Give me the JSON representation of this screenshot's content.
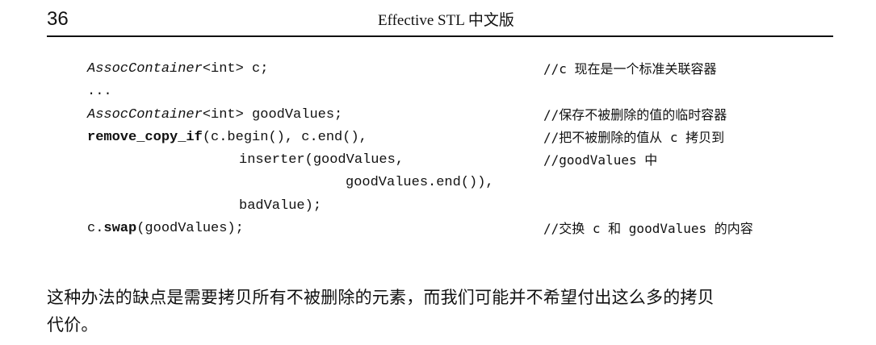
{
  "header": {
    "page_number": "36",
    "running_title": "Effective STL 中文版"
  },
  "code": {
    "line1": {
      "type_name": "AssocContainer",
      "rest": "<int> c;",
      "comment": "//c 现在是一个标准关联容器"
    },
    "line2": {
      "text": "..."
    },
    "line3": {
      "type_name": "AssocContainer",
      "rest": "<int> goodValues;",
      "comment": "//保存不被删除的值的临时容器"
    },
    "line4": {
      "func": "remove_copy_if",
      "rest": "(c.begin(), c.end(),",
      "comment": "//把不被删除的值从 c 拷贝到"
    },
    "line5": {
      "text": "inserter(goodValues,",
      "comment": "//goodValues 中"
    },
    "line6": {
      "text": "goodValues.end()),"
    },
    "line7": {
      "text": "badValue);"
    },
    "line8": {
      "prefix": "c.",
      "func": "swap",
      "rest": "(goodValues);",
      "comment": "//交换 c 和 goodValues 的内容"
    }
  },
  "paragraph": {
    "line1": "这种办法的缺点是需要拷贝所有不被删除的元素，而我们可能并不希望付出这么多的拷贝",
    "line2": "代价。"
  }
}
